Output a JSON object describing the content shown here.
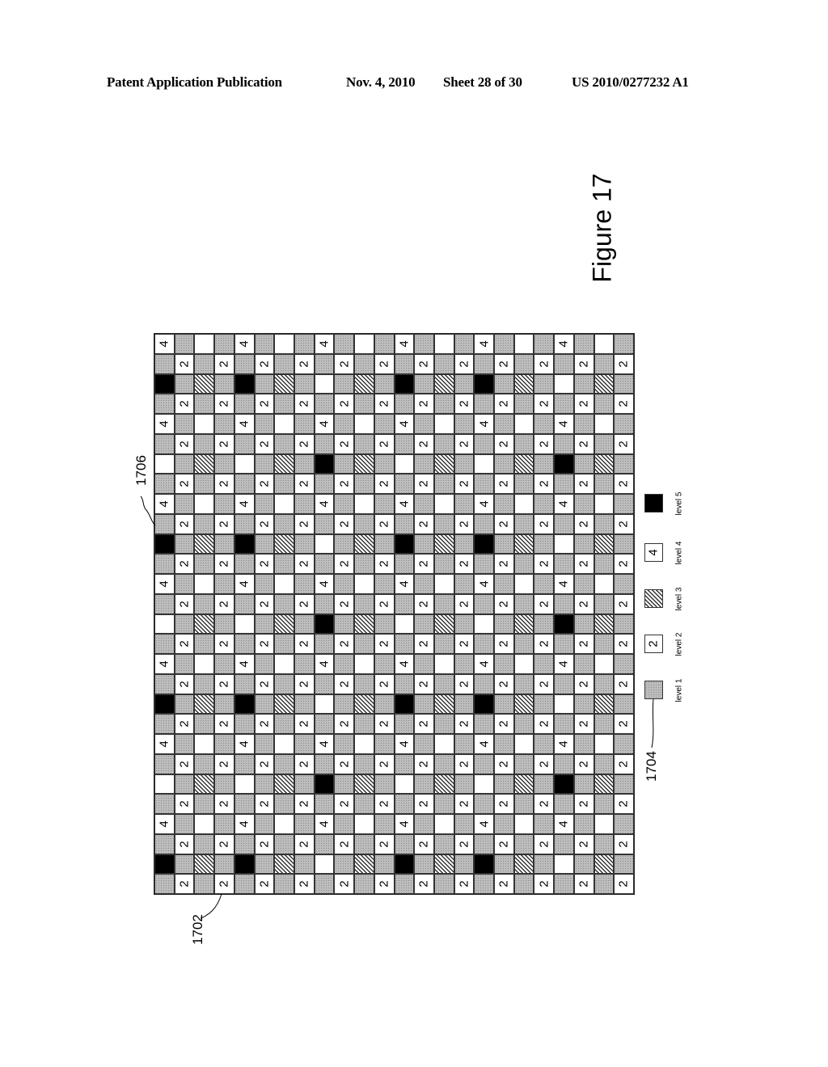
{
  "header": {
    "publication": "Patent Application Publication",
    "date": "Nov. 4, 2010",
    "sheet": "Sheet 28 of 30",
    "number": "US 2010/0277232 A1"
  },
  "figure": {
    "title": "Figure 17",
    "refs": {
      "grid": "1702",
      "legend": "1704",
      "cell": "1706"
    }
  },
  "legend": [
    {
      "code": "g",
      "label": "level 1",
      "glyph": ""
    },
    {
      "code": "2",
      "label": "level 2",
      "glyph": "2"
    },
    {
      "code": "h",
      "label": "level 3",
      "glyph": ""
    },
    {
      "code": "4",
      "label": "level 4",
      "glyph": "4"
    },
    {
      "code": "b",
      "label": "level 5",
      "glyph": ""
    }
  ],
  "grid": {
    "columns": 24,
    "rows_count": 28,
    "cell_codes": {
      "g": "level 1 (stippled gray)",
      "2": "level 2 (numeral 2)",
      "h": "level 3 (hatched)",
      "4": "level 4 (numeral 4)",
      "b": "level 5 (solid black)",
      "w": "blank"
    },
    "rows": [
      "4gwg4gwg4gwg4gwg4gwg4gwg",
      "g2g2g2g2g2g2g2g2g2g2g2g2",
      "bghgbghgwghgbghgbghgwghg",
      "g2g2g2g2g2g2g2g2g2g2g2g2",
      "4gwg4gwg4gwg4gwg4gwg4gwg",
      "g2g2g2g2g2g2g2g2g2g2g2g2",
      "wghgwghgbghgwghgwghgbghg",
      "g2g2g2g2g2g2g2g2g2g2g2g2",
      "4gwg4gwg4gwg4gwg4gwg4gwg",
      "g2g2g2g2g2g2g2g2g2g2g2g2",
      "bghgbghgwghgbghgbghgwghg",
      "g2g2g2g2g2g2g2g2g2g2g2g2",
      "4gwg4gwg4gwg4gwg4gwg4gwg",
      "g2g2g2g2g2g2g2g2g2g2g2g2",
      "wghgwghgbghgwghgwghgbghg",
      "g2g2g2g2g2g2g2g2g2g2g2g2",
      "4gwg4gwg4gwg4gwg4gwg4gwg",
      "g2g2g2g2g2g2g2g2g2g2g2g2",
      "bghgbghgwghgbghgbghgwghg",
      "g2g2g2g2g2g2g2g2g2g2g2g2",
      "4gwg4gwg4gwg4gwg4gwg4gwg",
      "g2g2g2g2g2g2g2g2g2g2g2g2",
      "wghgwghgbghgwghgwghgbghg",
      "g2g2g2g2g2g2g2g2g2g2g2g2",
      "4gwg4gwg4gwg4gwg4gwg4gwg",
      "g2g2g2g2g2g2g2g2g2g2g2g2",
      "bghgbghgwghgbghgbghgwghg",
      "g2g2g2g2g2g2g2g2g2g2g2g2"
    ]
  }
}
